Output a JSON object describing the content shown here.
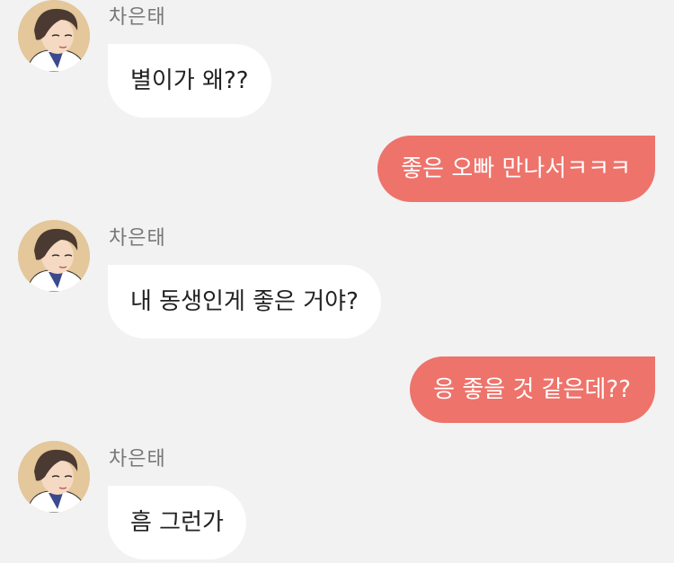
{
  "messages": [
    {
      "direction": "incoming",
      "sender": "차은태",
      "text": "별이가 왜??",
      "avatar_icon": "boy-avatar-icon"
    },
    {
      "direction": "outgoing",
      "text": "좋은 오빠 만나서ㅋㅋㅋ"
    },
    {
      "direction": "incoming",
      "sender": "차은태",
      "text": "내 동생인게 좋은 거야?",
      "avatar_icon": "boy-avatar-icon"
    },
    {
      "direction": "outgoing",
      "text": "응 좋을 것 같은데??"
    },
    {
      "direction": "incoming",
      "sender": "차은태",
      "text": "흠 그런가",
      "avatar_icon": "boy-avatar-icon"
    }
  ],
  "colors": {
    "background": "#f2f2f2",
    "incoming_bubble": "#ffffff",
    "outgoing_bubble": "#ee736b",
    "sender_name": "#777777"
  }
}
